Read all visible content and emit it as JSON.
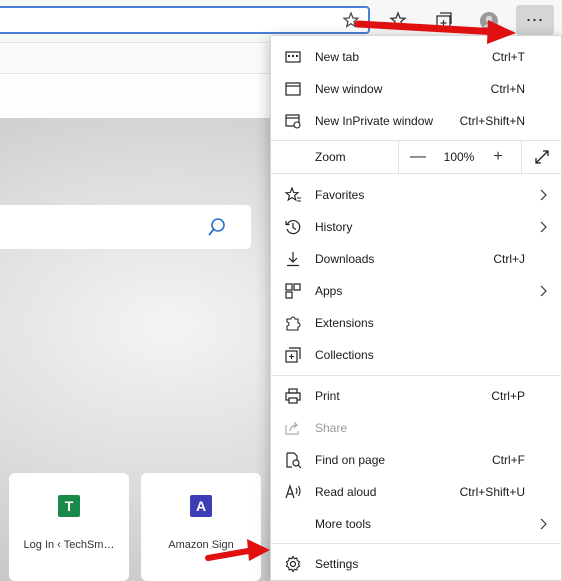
{
  "menu": {
    "group1": [
      {
        "label": "New tab",
        "shortcut": "Ctrl+T",
        "icon": "new-tab-icon"
      },
      {
        "label": "New window",
        "shortcut": "Ctrl+N",
        "icon": "new-window-icon"
      },
      {
        "label": "New InPrivate window",
        "shortcut": "Ctrl+Shift+N",
        "icon": "inprivate-icon"
      }
    ],
    "zoom": {
      "label": "Zoom",
      "minus": "—",
      "value": "100%",
      "plus": "+",
      "icon": "fullscreen-icon"
    },
    "group2": [
      {
        "label": "Favorites",
        "icon": "favorites-icon",
        "submenu": true
      },
      {
        "label": "History",
        "icon": "history-icon",
        "submenu": true
      },
      {
        "label": "Downloads",
        "shortcut": "Ctrl+J",
        "icon": "downloads-icon"
      },
      {
        "label": "Apps",
        "icon": "apps-icon",
        "submenu": true
      },
      {
        "label": "Extensions",
        "icon": "extensions-icon"
      },
      {
        "label": "Collections",
        "icon": "collections-icon"
      }
    ],
    "group3": [
      {
        "label": "Print",
        "shortcut": "Ctrl+P",
        "icon": "print-icon"
      },
      {
        "label": "Share",
        "icon": "share-icon",
        "disabled": true
      },
      {
        "label": "Find on page",
        "shortcut": "Ctrl+F",
        "icon": "find-icon"
      },
      {
        "label": "Read aloud",
        "shortcut": "Ctrl+Shift+U",
        "icon": "read-aloud-icon"
      },
      {
        "label": "More tools",
        "submenu": true
      }
    ],
    "settings": {
      "label": "Settings",
      "icon": "gear-icon"
    }
  },
  "toolbar": {
    "more_label": "⋯"
  },
  "tiles": [
    {
      "letter": "T",
      "label": "Log In ‹ TechSm…",
      "color": "#1a8a4a"
    },
    {
      "letter": "A",
      "label": "Amazon Sign",
      "color": "#3d3db8"
    }
  ],
  "colors": {
    "arrow": "#e01010",
    "accent": "#4a7fd6"
  }
}
